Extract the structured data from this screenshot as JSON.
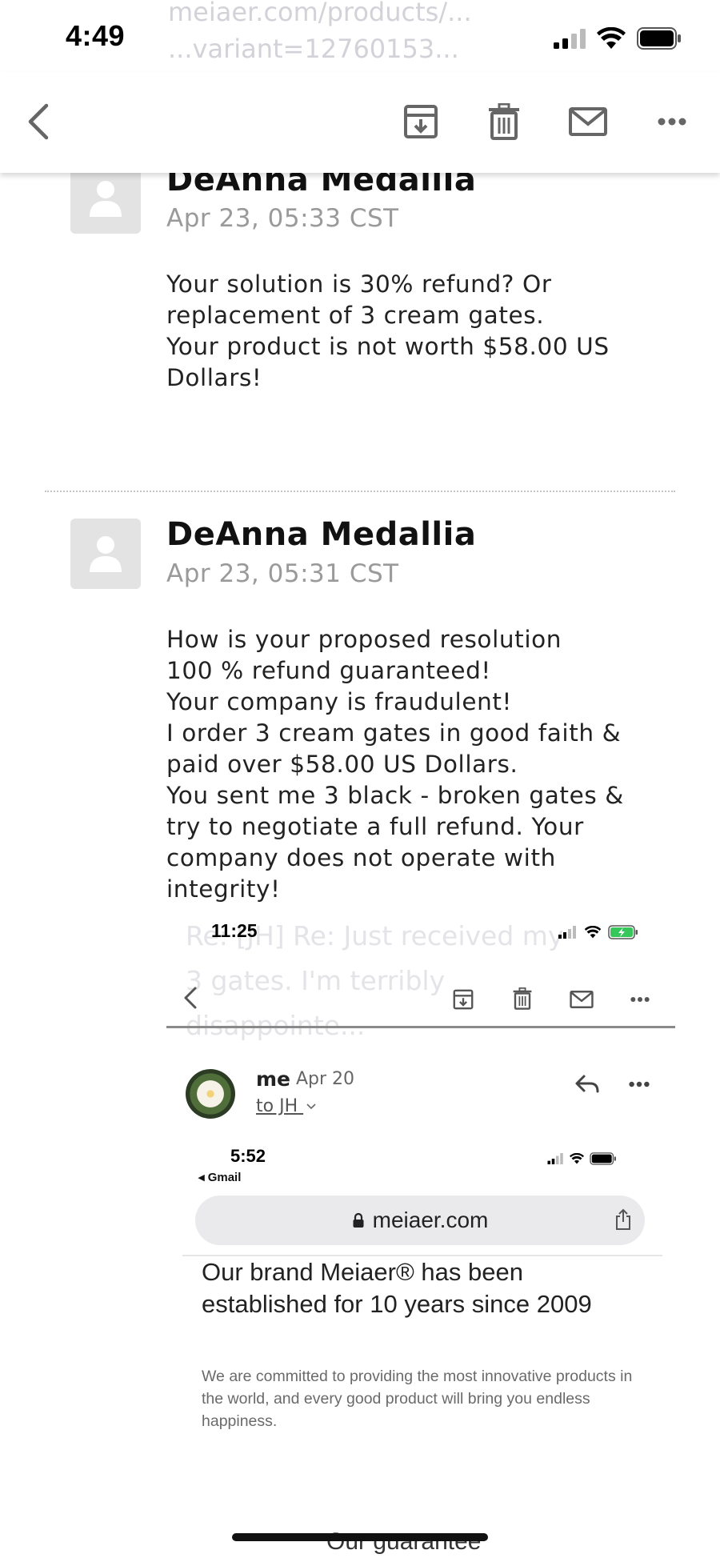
{
  "status_bar": {
    "time": "4:49",
    "ghost_url": "meiaer.com/products/...\n...variant=12760153...",
    "icons": [
      "signal-icon",
      "wifi-icon",
      "battery-icon"
    ]
  },
  "toolbar": {
    "icons": [
      "back-icon",
      "archive-icon",
      "trash-icon",
      "mail-icon",
      "more-icon"
    ]
  },
  "messages": [
    {
      "sender": "DeAnna Medallia",
      "date": "Apr 23, 05:33 CST",
      "body": [
        "Your solution is 30% refund? Or",
        "replacement of 3 cream gates.",
        "Your product is not worth $58.00 US",
        "Dollars!"
      ]
    },
    {
      "sender": "DeAnna Medallia",
      "date": "Apr 23, 05:31 CST",
      "body": [
        "How is your proposed resolution",
        "100 % refund guaranteed!",
        "Your company is fraudulent!",
        "I order 3 cream gates in good faith &",
        "paid over $58.00 US Dollars.",
        "You sent me 3 black - broken gates &",
        "try to negotiate a full refund. Your",
        "company does not operate with",
        "integrity!"
      ]
    }
  ],
  "embedded": {
    "time": "11:25",
    "ghost_subject": "Re: [JH] Re: Just received my\n3 gates. I'm terribly\ndisappointe...",
    "sender": "me",
    "date": "Apr 20",
    "to": "to JH",
    "inner": {
      "time": "5:52",
      "back_label": "◂ Gmail",
      "url": "meiaer.com",
      "headline": "Our brand Meiaer® has been established for 10 years since 2009",
      "subtext": "We are committed to providing the most innovative products in the world, and every good product will bring you endless happiness.",
      "cut_heading": "Our guarantee"
    }
  }
}
